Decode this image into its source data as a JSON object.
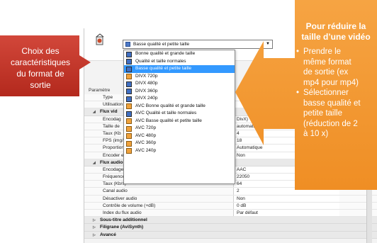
{
  "callouts": {
    "left_text": [
      "Choix des",
      "caractéristiques",
      "du format de",
      "sortie"
    ],
    "right_title": [
      "Pour réduire la",
      "taille d’une vidéo"
    ],
    "right_bullet1": [
      "Prendre le",
      "même format",
      "de sortie (ex",
      "mp4 pour mp4)"
    ],
    "right_bullet2": [
      "Sélectionner",
      "basse qualité et",
      "petite taille",
      "(réduction de 2",
      "à 10 x)"
    ],
    "bullet_glyph": "•",
    "left_color": "#c0392b",
    "right_color": "#f39c33"
  },
  "format_select": {
    "value": "Basse qualité et petite taille",
    "caret": "▼"
  },
  "dropdown_options": [
    {
      "label": "Bonne qualité et grande taille",
      "color": "blue",
      "selected": false
    },
    {
      "label": "Qualité et taille normales",
      "color": "blue",
      "selected": false
    },
    {
      "label": "Basse qualité et petite taille",
      "color": "blue",
      "selected": true
    },
    {
      "label": "DIVX 720p",
      "color": "orange",
      "selected": false
    },
    {
      "label": "DIVX 480p",
      "color": "blue",
      "selected": false
    },
    {
      "label": "DIVX 360p",
      "color": "blue",
      "selected": false
    },
    {
      "label": "DIVX 240p",
      "color": "blue",
      "selected": false
    },
    {
      "label": "AVC Bonne qualité et grande taille",
      "color": "orange",
      "selected": false
    },
    {
      "label": "AVC Qualité et taille normales",
      "color": "blue",
      "selected": false
    },
    {
      "label": "AVC Basse qualité et petite taille",
      "color": "orange",
      "selected": false
    },
    {
      "label": "AVC 720p",
      "color": "orange",
      "selected": false
    },
    {
      "label": "AVC 480p",
      "color": "orange",
      "selected": false
    },
    {
      "label": "AVC 360p",
      "color": "orange",
      "selected": false
    },
    {
      "label": "AVC 240p",
      "color": "orange",
      "selected": false
    }
  ],
  "properties": {
    "header": "Paramètre",
    "rows": [
      {
        "kind": "row",
        "name": "Type",
        "value": ""
      },
      {
        "kind": "row",
        "name": "Utilisation d",
        "value": ""
      },
      {
        "kind": "group",
        "name": "Flux vid",
        "open": true
      },
      {
        "kind": "row",
        "name": "Encodag",
        "value": "DivX)"
      },
      {
        "kind": "row",
        "name": "Taille de",
        "value": "automatique240"
      },
      {
        "kind": "row",
        "name": "Taux (Kb",
        "value": "4"
      },
      {
        "kind": "row",
        "name": "FPS (img/s)",
        "value": "18"
      },
      {
        "kind": "row",
        "name": "Proportions",
        "value": "Automatique"
      },
      {
        "kind": "row",
        "name": "Encoder en 2 passes",
        "value": "Non"
      },
      {
        "kind": "group",
        "name": "Flux audio",
        "open": true
      },
      {
        "kind": "row",
        "name": "Encodage audio",
        "value": "AAC"
      },
      {
        "kind": "row",
        "name": "Fréquence d'échantillonnage (Hz)",
        "value": "22050"
      },
      {
        "kind": "row",
        "name": "Taux (Kb/s)",
        "value": "64"
      },
      {
        "kind": "row",
        "name": "Canal audio",
        "value": "2"
      },
      {
        "kind": "row",
        "name": "Désactiver audio",
        "value": "Non"
      },
      {
        "kind": "row",
        "name": "Contrôle de volume (+dB)",
        "value": "0 dB"
      },
      {
        "kind": "row",
        "name": "Index du flux audio",
        "value": "Par défaut"
      },
      {
        "kind": "group",
        "name": "Sous-titre additionnel",
        "open": false
      },
      {
        "kind": "group",
        "name": "Filigrane (AviSynth)",
        "open": false
      },
      {
        "kind": "group",
        "name": "Avancé",
        "open": false
      }
    ]
  },
  "icons": {
    "open_group": "◢",
    "closed_group": "▷"
  }
}
